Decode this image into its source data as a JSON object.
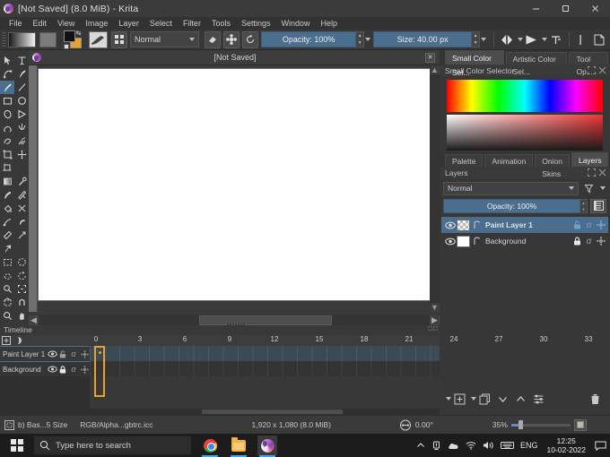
{
  "window": {
    "title": "[Not Saved] (8.0 MiB) - Krita",
    "app_icon": "krita-logo-icon",
    "controls": {
      "minimize": "minimize-icon",
      "maximize": "maximize-icon",
      "close": "close-icon"
    }
  },
  "menubar": {
    "items": [
      "File",
      "Edit",
      "View",
      "Image",
      "Layer",
      "Select",
      "Filter",
      "Tools",
      "Settings",
      "Window",
      "Help"
    ]
  },
  "toolbar": {
    "blend_mode": "Normal",
    "opacity_label": "Opacity: 100%",
    "size_label": "Size: 40.00 px",
    "icons": [
      "gradient-swatch-icon",
      "pattern-swatch-icon",
      "fg-bg-color-icon",
      "brush-preset-icon",
      "brush-presets-grid-icon",
      "eraser-icon",
      "alpha-mask-icon",
      "reload-preset-icon",
      "mirror-horizontal-icon",
      "mirror-vertical-icon",
      "wrap-around-icon",
      "assistants-icon",
      "canvas-only-icon"
    ]
  },
  "toolbox": {
    "active_tool": "freehand-brush-tool",
    "tools": [
      "select-shapes-tool",
      "text-tool",
      "edit-shapes-tool",
      "calligraphy-tool",
      "freehand-brush-tool",
      "line-tool",
      "rectangle-tool",
      "ellipse-tool",
      "polygon-tool",
      "polyline-tool",
      "bezier-curve-tool",
      "freehand-path-tool",
      "dynamic-brush-tool",
      "multibrush-tool",
      "transform-tool",
      "move-tool",
      "crop-tool",
      "",
      "gradient-tool",
      "color-sampler-tool",
      "colorize-mask-tool",
      "smart-patch-tool",
      "fill-tool",
      "enclose-and-fill-tool",
      "gradient-edit-tool",
      "measure-tool",
      "reference-images-tool",
      "",
      "rectangular-selection-tool",
      "elliptical-selection-tool",
      "polygonal-selection-tool",
      "freehand-selection-tool",
      "contiguous-selection-tool",
      "similar-color-selection-tool",
      "bezier-selection-tool",
      "magnetic-selection-tool",
      "zoom-tool",
      "pan-tool"
    ]
  },
  "canvas": {
    "tab_title": "[Not Saved]",
    "close_icon": "close-icon",
    "document_icon": "krita-logo-icon"
  },
  "dockers": {
    "color_group": {
      "tabs": [
        {
          "label": "Small Color Sel...",
          "active": true
        },
        {
          "label": "Artistic Color Sel...",
          "active": false
        },
        {
          "label": "Tool Op...",
          "active": false
        }
      ],
      "header": "Small Color Selector",
      "header_icons": [
        "float-docker-icon",
        "close-docker-icon"
      ]
    },
    "layer_group": {
      "tabs": [
        {
          "label": "Palette",
          "active": false
        },
        {
          "label": "Animation",
          "active": false
        },
        {
          "label": "Onion Skins",
          "active": false
        },
        {
          "label": "Layers",
          "active": true
        }
      ],
      "header": "Layers",
      "header_icons": [
        "float-docker-icon",
        "close-docker-icon"
      ],
      "blend_mode": "Normal",
      "filter_icon": "filter-funnel-icon",
      "opacity_label": "Opacity:  100%",
      "properties_icon": "layer-properties-icon",
      "layers": [
        {
          "name": "Paint Layer 1",
          "selected": true,
          "thumb": "checker",
          "visible_icon": "eye-icon",
          "onion_icon": "onion-skin-icon",
          "icons": [
            "lock-open-icon",
            "alpha-lock-icon",
            "layer-style-icon"
          ]
        },
        {
          "name": "Background",
          "selected": false,
          "thumb": "white",
          "visible_icon": "eye-icon",
          "onion_icon": "onion-skin-icon",
          "icons": [
            "lock-closed-icon",
            "alpha-lock-icon",
            "layer-style-icon"
          ]
        }
      ],
      "toolbar_icons": [
        "add-layer-icon",
        "add-layer-dropdown-icon",
        "duplicate-layer-icon",
        "move-layer-down-icon",
        "move-layer-up-icon",
        "layer-properties-sliders-icon",
        "delete-layer-icon"
      ]
    }
  },
  "timeline": {
    "title": "Timeline",
    "toolbar_icons": [
      "add-keyframe-icon",
      "onion-skin-toggle-icon",
      "auto-key-icon"
    ],
    "ruler_ticks": [
      "0",
      "3",
      "6",
      "9",
      "12",
      "15",
      "18",
      "21",
      "24",
      "27",
      "30",
      "33"
    ],
    "rows": [
      {
        "name": "Paint Layer 1",
        "icons": [
          "eye-icon",
          "lock-open-icon",
          "alpha-lock-icon",
          "layer-style-icon"
        ],
        "has_keyframe": true
      },
      {
        "name": "Background",
        "icons": [
          "eye-icon",
          "lock-closed-icon",
          "alpha-lock-icon",
          "layer-style-icon"
        ],
        "has_keyframe": false
      }
    ],
    "playhead_frame": "0",
    "playhead_color": "#e8a22c"
  },
  "statusbar": {
    "selection_icon": "selection-mask-icon",
    "brush_info": "b) Bas...5 Size",
    "color_profile": "RGB/Alpha...gbtrc.icc",
    "dimensions": "1,920 x 1,080 (8.0 MiB)",
    "rotation_icon": "rotation-icon",
    "rotation": "0.00°",
    "zoom": "35%",
    "fit_icon": "fit-page-icon"
  },
  "taskbar": {
    "start_icon": "windows-start-icon",
    "search_placeholder": "Type here to search",
    "search_icon": "search-icon",
    "apps": [
      "chrome-icon",
      "file-explorer-icon",
      "krita-icon"
    ],
    "tray": {
      "chevron_icon": "chevron-up-icon",
      "icons": [
        "onedrive-sync-icon",
        "cloud-icon",
        "wifi-icon",
        "volume-icon",
        "keyboard-icon"
      ],
      "language": "ENG",
      "time": "12:25",
      "date": "10-02-2022",
      "notification_icon": "notification-icon"
    }
  },
  "colors": {
    "accent": "#4b6e8e",
    "highlight": "#e8a22c",
    "panel": "#373737",
    "toolbar": "#3b3b3b"
  }
}
